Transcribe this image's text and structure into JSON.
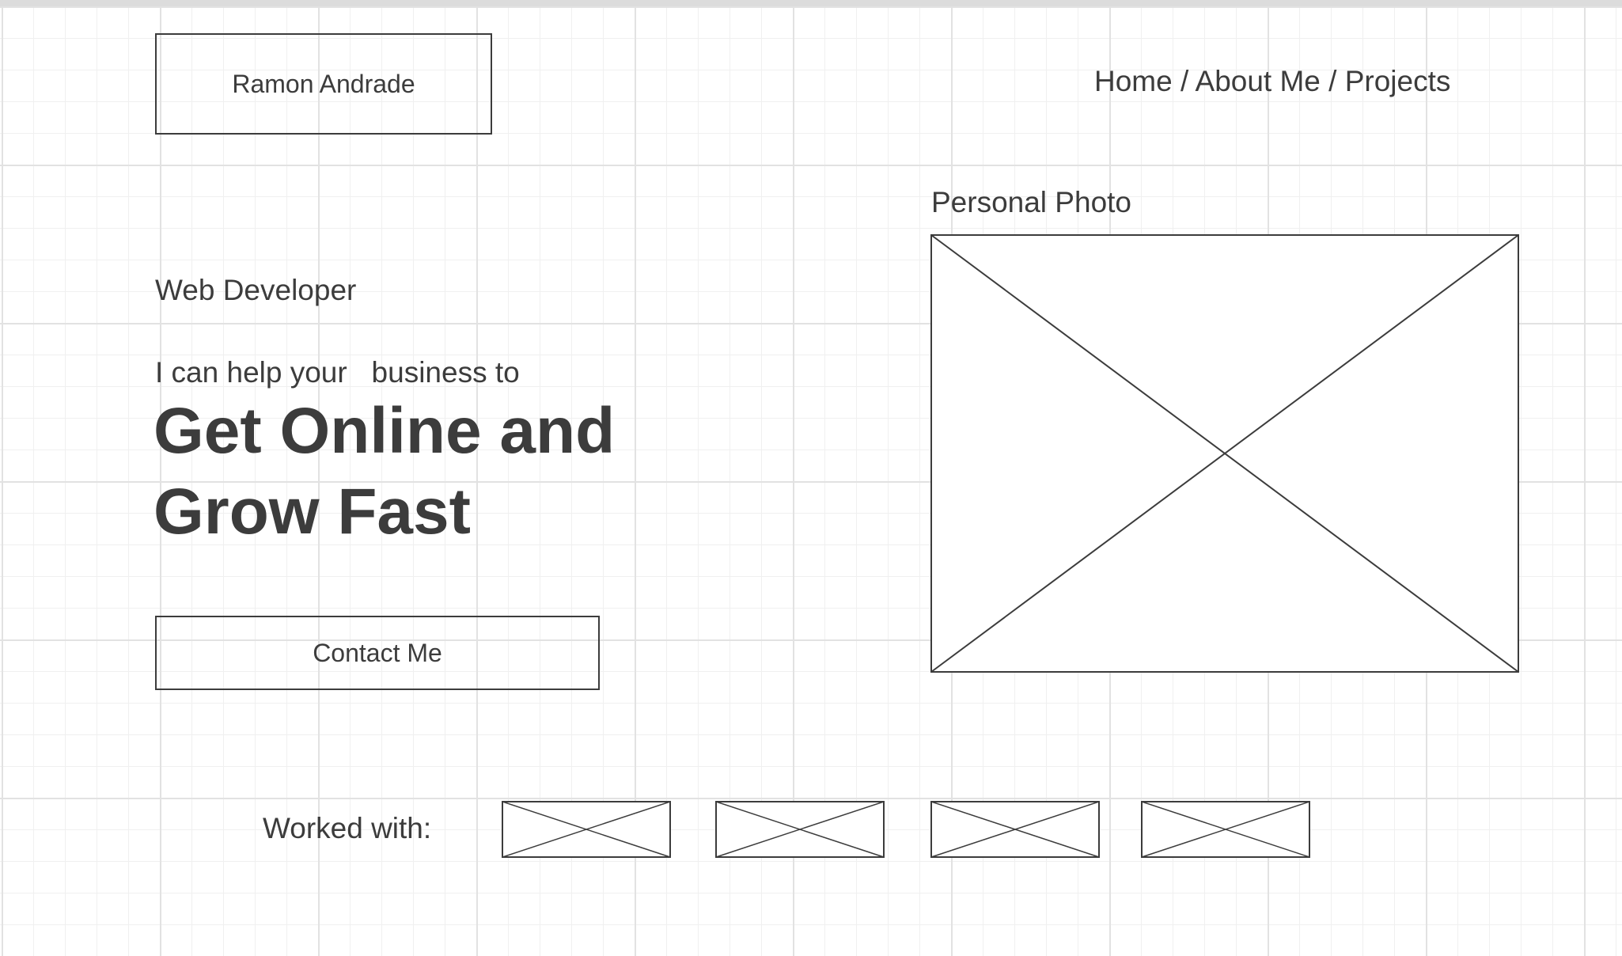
{
  "header": {
    "brand_name": "Ramon Andrade",
    "nav": {
      "home": "Home",
      "about": "About Me",
      "projects": "Projects",
      "separator": " / "
    }
  },
  "hero": {
    "role": "Web Developer",
    "pitch": "I can help your   business to",
    "headline_line1": "Get Online and",
    "headline_line2": "Grow Fast",
    "cta_label": "Contact Me"
  },
  "photo": {
    "label": "Personal Photo"
  },
  "clients": {
    "label": "Worked with:",
    "logo_count": 4
  },
  "colors": {
    "stroke": "#3c3c3c",
    "grid_major": "#e2e2e2",
    "grid_minor": "#f0f0f0"
  }
}
